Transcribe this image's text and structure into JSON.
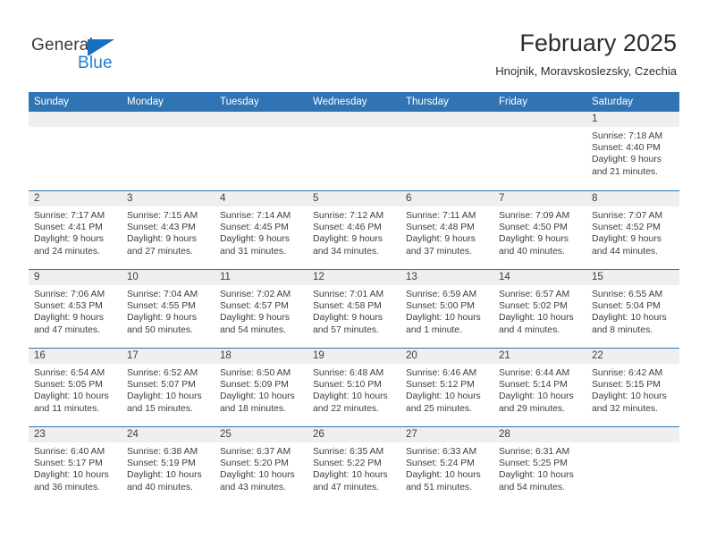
{
  "brand": {
    "name_top": "General",
    "name_bottom": "Blue",
    "accent_color": "#1b7fd4",
    "triangle_color": "#176fc1"
  },
  "header": {
    "title": "February 2025",
    "subtitle": "Hnojnik, Moravskoslezsky, Czechia"
  },
  "theme": {
    "header_blue": "#3074b4",
    "daynum_band": "#efefef",
    "text": "#3d3d3d"
  },
  "calendar": {
    "weekday_headers": [
      "Sunday",
      "Monday",
      "Tuesday",
      "Wednesday",
      "Thursday",
      "Friday",
      "Saturday"
    ],
    "weeks": [
      [
        {
          "day": "",
          "empty": true
        },
        {
          "day": "",
          "empty": true
        },
        {
          "day": "",
          "empty": true
        },
        {
          "day": "",
          "empty": true
        },
        {
          "day": "",
          "empty": true
        },
        {
          "day": "",
          "empty": true
        },
        {
          "day": "1",
          "sunrise": "Sunrise: 7:18 AM",
          "sunset": "Sunset: 4:40 PM",
          "daylight1": "Daylight: 9 hours",
          "daylight2": "and 21 minutes."
        }
      ],
      [
        {
          "day": "2",
          "sunrise": "Sunrise: 7:17 AM",
          "sunset": "Sunset: 4:41 PM",
          "daylight1": "Daylight: 9 hours",
          "daylight2": "and 24 minutes."
        },
        {
          "day": "3",
          "sunrise": "Sunrise: 7:15 AM",
          "sunset": "Sunset: 4:43 PM",
          "daylight1": "Daylight: 9 hours",
          "daylight2": "and 27 minutes."
        },
        {
          "day": "4",
          "sunrise": "Sunrise: 7:14 AM",
          "sunset": "Sunset: 4:45 PM",
          "daylight1": "Daylight: 9 hours",
          "daylight2": "and 31 minutes."
        },
        {
          "day": "5",
          "sunrise": "Sunrise: 7:12 AM",
          "sunset": "Sunset: 4:46 PM",
          "daylight1": "Daylight: 9 hours",
          "daylight2": "and 34 minutes."
        },
        {
          "day": "6",
          "sunrise": "Sunrise: 7:11 AM",
          "sunset": "Sunset: 4:48 PM",
          "daylight1": "Daylight: 9 hours",
          "daylight2": "and 37 minutes."
        },
        {
          "day": "7",
          "sunrise": "Sunrise: 7:09 AM",
          "sunset": "Sunset: 4:50 PM",
          "daylight1": "Daylight: 9 hours",
          "daylight2": "and 40 minutes."
        },
        {
          "day": "8",
          "sunrise": "Sunrise: 7:07 AM",
          "sunset": "Sunset: 4:52 PM",
          "daylight1": "Daylight: 9 hours",
          "daylight2": "and 44 minutes."
        }
      ],
      [
        {
          "day": "9",
          "sunrise": "Sunrise: 7:06 AM",
          "sunset": "Sunset: 4:53 PM",
          "daylight1": "Daylight: 9 hours",
          "daylight2": "and 47 minutes."
        },
        {
          "day": "10",
          "sunrise": "Sunrise: 7:04 AM",
          "sunset": "Sunset: 4:55 PM",
          "daylight1": "Daylight: 9 hours",
          "daylight2": "and 50 minutes."
        },
        {
          "day": "11",
          "sunrise": "Sunrise: 7:02 AM",
          "sunset": "Sunset: 4:57 PM",
          "daylight1": "Daylight: 9 hours",
          "daylight2": "and 54 minutes."
        },
        {
          "day": "12",
          "sunrise": "Sunrise: 7:01 AM",
          "sunset": "Sunset: 4:58 PM",
          "daylight1": "Daylight: 9 hours",
          "daylight2": "and 57 minutes."
        },
        {
          "day": "13",
          "sunrise": "Sunrise: 6:59 AM",
          "sunset": "Sunset: 5:00 PM",
          "daylight1": "Daylight: 10 hours",
          "daylight2": "and 1 minute."
        },
        {
          "day": "14",
          "sunrise": "Sunrise: 6:57 AM",
          "sunset": "Sunset: 5:02 PM",
          "daylight1": "Daylight: 10 hours",
          "daylight2": "and 4 minutes."
        },
        {
          "day": "15",
          "sunrise": "Sunrise: 6:55 AM",
          "sunset": "Sunset: 5:04 PM",
          "daylight1": "Daylight: 10 hours",
          "daylight2": "and 8 minutes."
        }
      ],
      [
        {
          "day": "16",
          "sunrise": "Sunrise: 6:54 AM",
          "sunset": "Sunset: 5:05 PM",
          "daylight1": "Daylight: 10 hours",
          "daylight2": "and 11 minutes."
        },
        {
          "day": "17",
          "sunrise": "Sunrise: 6:52 AM",
          "sunset": "Sunset: 5:07 PM",
          "daylight1": "Daylight: 10 hours",
          "daylight2": "and 15 minutes."
        },
        {
          "day": "18",
          "sunrise": "Sunrise: 6:50 AM",
          "sunset": "Sunset: 5:09 PM",
          "daylight1": "Daylight: 10 hours",
          "daylight2": "and 18 minutes."
        },
        {
          "day": "19",
          "sunrise": "Sunrise: 6:48 AM",
          "sunset": "Sunset: 5:10 PM",
          "daylight1": "Daylight: 10 hours",
          "daylight2": "and 22 minutes."
        },
        {
          "day": "20",
          "sunrise": "Sunrise: 6:46 AM",
          "sunset": "Sunset: 5:12 PM",
          "daylight1": "Daylight: 10 hours",
          "daylight2": "and 25 minutes."
        },
        {
          "day": "21",
          "sunrise": "Sunrise: 6:44 AM",
          "sunset": "Sunset: 5:14 PM",
          "daylight1": "Daylight: 10 hours",
          "daylight2": "and 29 minutes."
        },
        {
          "day": "22",
          "sunrise": "Sunrise: 6:42 AM",
          "sunset": "Sunset: 5:15 PM",
          "daylight1": "Daylight: 10 hours",
          "daylight2": "and 32 minutes."
        }
      ],
      [
        {
          "day": "23",
          "sunrise": "Sunrise: 6:40 AM",
          "sunset": "Sunset: 5:17 PM",
          "daylight1": "Daylight: 10 hours",
          "daylight2": "and 36 minutes."
        },
        {
          "day": "24",
          "sunrise": "Sunrise: 6:38 AM",
          "sunset": "Sunset: 5:19 PM",
          "daylight1": "Daylight: 10 hours",
          "daylight2": "and 40 minutes."
        },
        {
          "day": "25",
          "sunrise": "Sunrise: 6:37 AM",
          "sunset": "Sunset: 5:20 PM",
          "daylight1": "Daylight: 10 hours",
          "daylight2": "and 43 minutes."
        },
        {
          "day": "26",
          "sunrise": "Sunrise: 6:35 AM",
          "sunset": "Sunset: 5:22 PM",
          "daylight1": "Daylight: 10 hours",
          "daylight2": "and 47 minutes."
        },
        {
          "day": "27",
          "sunrise": "Sunrise: 6:33 AM",
          "sunset": "Sunset: 5:24 PM",
          "daylight1": "Daylight: 10 hours",
          "daylight2": "and 51 minutes."
        },
        {
          "day": "28",
          "sunrise": "Sunrise: 6:31 AM",
          "sunset": "Sunset: 5:25 PM",
          "daylight1": "Daylight: 10 hours",
          "daylight2": "and 54 minutes."
        },
        {
          "day": "",
          "empty": true
        }
      ]
    ]
  }
}
